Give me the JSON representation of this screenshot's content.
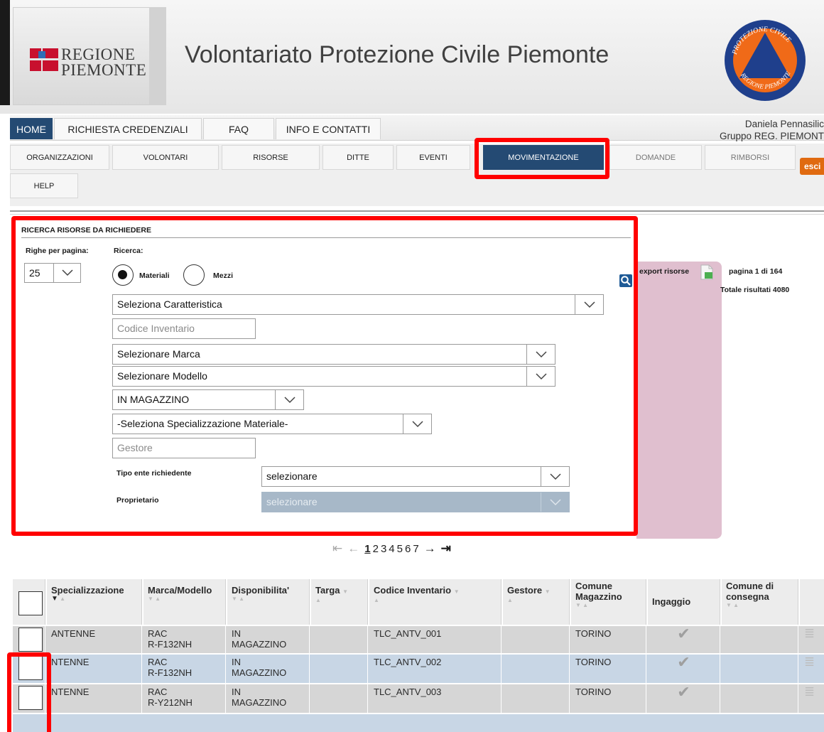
{
  "header": {
    "logo_line1": "REGIONE",
    "logo_line2": "PIEMONTE",
    "title": "Volontariato Protezione Civile Piemonte",
    "emblem_top_text": "PROTEZIONE CIVILE",
    "emblem_bottom_text": "REGIONE PIEMONTE"
  },
  "topnav": {
    "items": [
      "HOME",
      "RICHIESTA CREDENZIALI",
      "FAQ",
      "INFO E CONTATTI"
    ],
    "user_name": "Daniela Pennasilic",
    "user_group": "Gruppo REG. PIEMONT"
  },
  "subnav": {
    "items": [
      "ORGANIZZAZIONI",
      "VOLONTARI",
      "RISORSE",
      "DITTE",
      "EVENTI",
      "MOVIMENTAZIONE",
      "DOMANDE",
      "RIMBORSI",
      "HELP"
    ],
    "esci_label": "esci"
  },
  "search": {
    "title": "RICERCA RISORSE DA RICHIEDERE",
    "rows_label": "Righe per pagina:",
    "rows_value": "25",
    "search_label": "Ricerca:",
    "radio_materiali": "Materiali",
    "radio_mezzi": "Mezzi",
    "caratteristica": "Seleziona Caratteristica",
    "codice_placeholder": "Codice Inventario",
    "marca": "Selezionare Marca",
    "modello": "Selezionare Modello",
    "stato": "IN MAGAZZINO",
    "specializzazione": "-Seleziona Specializzazione Materiale-",
    "gestore_placeholder": "Gestore",
    "tipo_ente_label": "Tipo ente richiedente",
    "tipo_ente_value": "selezionare",
    "proprietario_label": "Proprietario",
    "proprietario_value": "selezionare",
    "export_label": "export risorse",
    "page_info": "pagina 1 di 164",
    "total_info": "Totale risultati 4080"
  },
  "pagination": {
    "current": "1",
    "pages": [
      "2",
      "3",
      "4",
      "5",
      "6",
      "7"
    ]
  },
  "table": {
    "headers": [
      "Specializzazione",
      "Marca/Modello",
      "Disponibilita'",
      "Targa",
      "Codice Inventario",
      "Gestore",
      "Comune Magazzino",
      "Ingaggio",
      "Comune di consegna"
    ],
    "rows": [
      {
        "spec": "ANTENNE",
        "marca1": "RAC",
        "marca2": "R-F132NH",
        "disp1": "IN",
        "disp2": "MAGAZZINO",
        "targa": "",
        "codice": "TLC_ANTV_001",
        "gestore": "",
        "comune": "TORINO",
        "consegna": ""
      },
      {
        "spec": "NTENNE",
        "marca1": "RAC",
        "marca2": "R-F132NH",
        "disp1": "IN",
        "disp2": "MAGAZZINO",
        "targa": "",
        "codice": "TLC_ANTV_002",
        "gestore": "",
        "comune": "TORINO",
        "consegna": ""
      },
      {
        "spec": "NTENNE",
        "marca1": "RAC",
        "marca2": "R-Y212NH",
        "disp1": "IN",
        "disp2": "MAGAZZINO",
        "targa": "",
        "codice": "TLC_ANTV_003",
        "gestore": "",
        "comune": "TORINO",
        "consegna": ""
      }
    ]
  },
  "colors": {
    "nav_active": "#244a73",
    "highlight": "#ff0000",
    "row_alt": "#c8d6e5",
    "row_default": "#d6d6d6",
    "results_panel": "#e0bfcf",
    "esci": "#e06a10"
  }
}
